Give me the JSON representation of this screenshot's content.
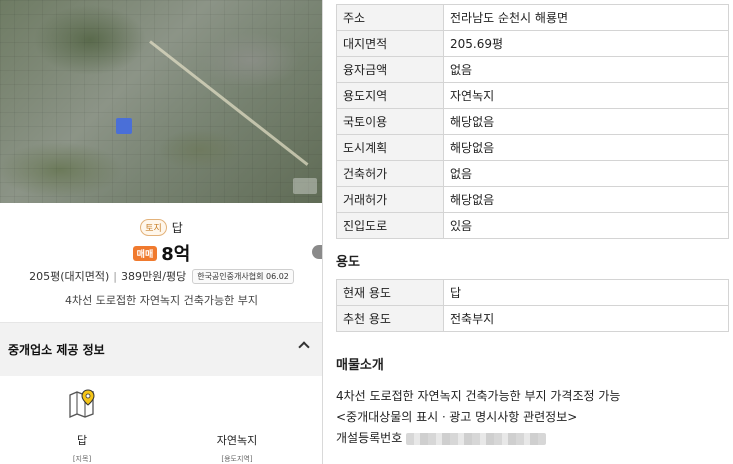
{
  "listing": {
    "land_badge": "토지",
    "land_type": "답",
    "sale_badge": "매매",
    "price": "8억",
    "area": "205평(대지면적)",
    "separator": "|",
    "price_per_pyeong": "389만원/평당",
    "association_badge": "한국공인중개사협회 06.02",
    "description": "4차선 도로접한 자연녹지 건축가능한 부지"
  },
  "broker_section": {
    "title": "중개업소 제공 정보",
    "items": [
      {
        "label": "답",
        "sub": "[지목]"
      },
      {
        "label": "자연녹지",
        "sub": "[용도지역]"
      }
    ]
  },
  "details": [
    {
      "key": "주소",
      "value": "전라남도 순천시 해룡면"
    },
    {
      "key": "대지면적",
      "value": "205.69평"
    },
    {
      "key": "융자금액",
      "value": "없음"
    },
    {
      "key": "용도지역",
      "value": "자연녹지"
    },
    {
      "key": "국토이용",
      "value": "해당없음"
    },
    {
      "key": "도시계획",
      "value": "해당없음"
    },
    {
      "key": "건축허가",
      "value": "없음"
    },
    {
      "key": "거래허가",
      "value": "해당없음"
    },
    {
      "key": "진입도로",
      "value": "있음"
    }
  ],
  "usage": {
    "heading": "용도",
    "rows": [
      {
        "key": "현재 용도",
        "value": "답"
      },
      {
        "key": "추천 용도",
        "value": "전축부지"
      }
    ]
  },
  "intro": {
    "heading": "매물소개",
    "line1": "4차선 도로접한 자연녹지 건축가능한 부지 가격조정 가능",
    "line2": "<중개대상물의 표시ㆍ광고 명시사항 관련정보>",
    "line3": "개설등록번호"
  },
  "colors": {
    "accent_orange": "#f07a2e",
    "land_badge": "#c9832f",
    "map_pin": "#f5c518"
  },
  "icons": [
    "map-icon",
    "chevron-up-icon",
    "map-marker-icon"
  ]
}
